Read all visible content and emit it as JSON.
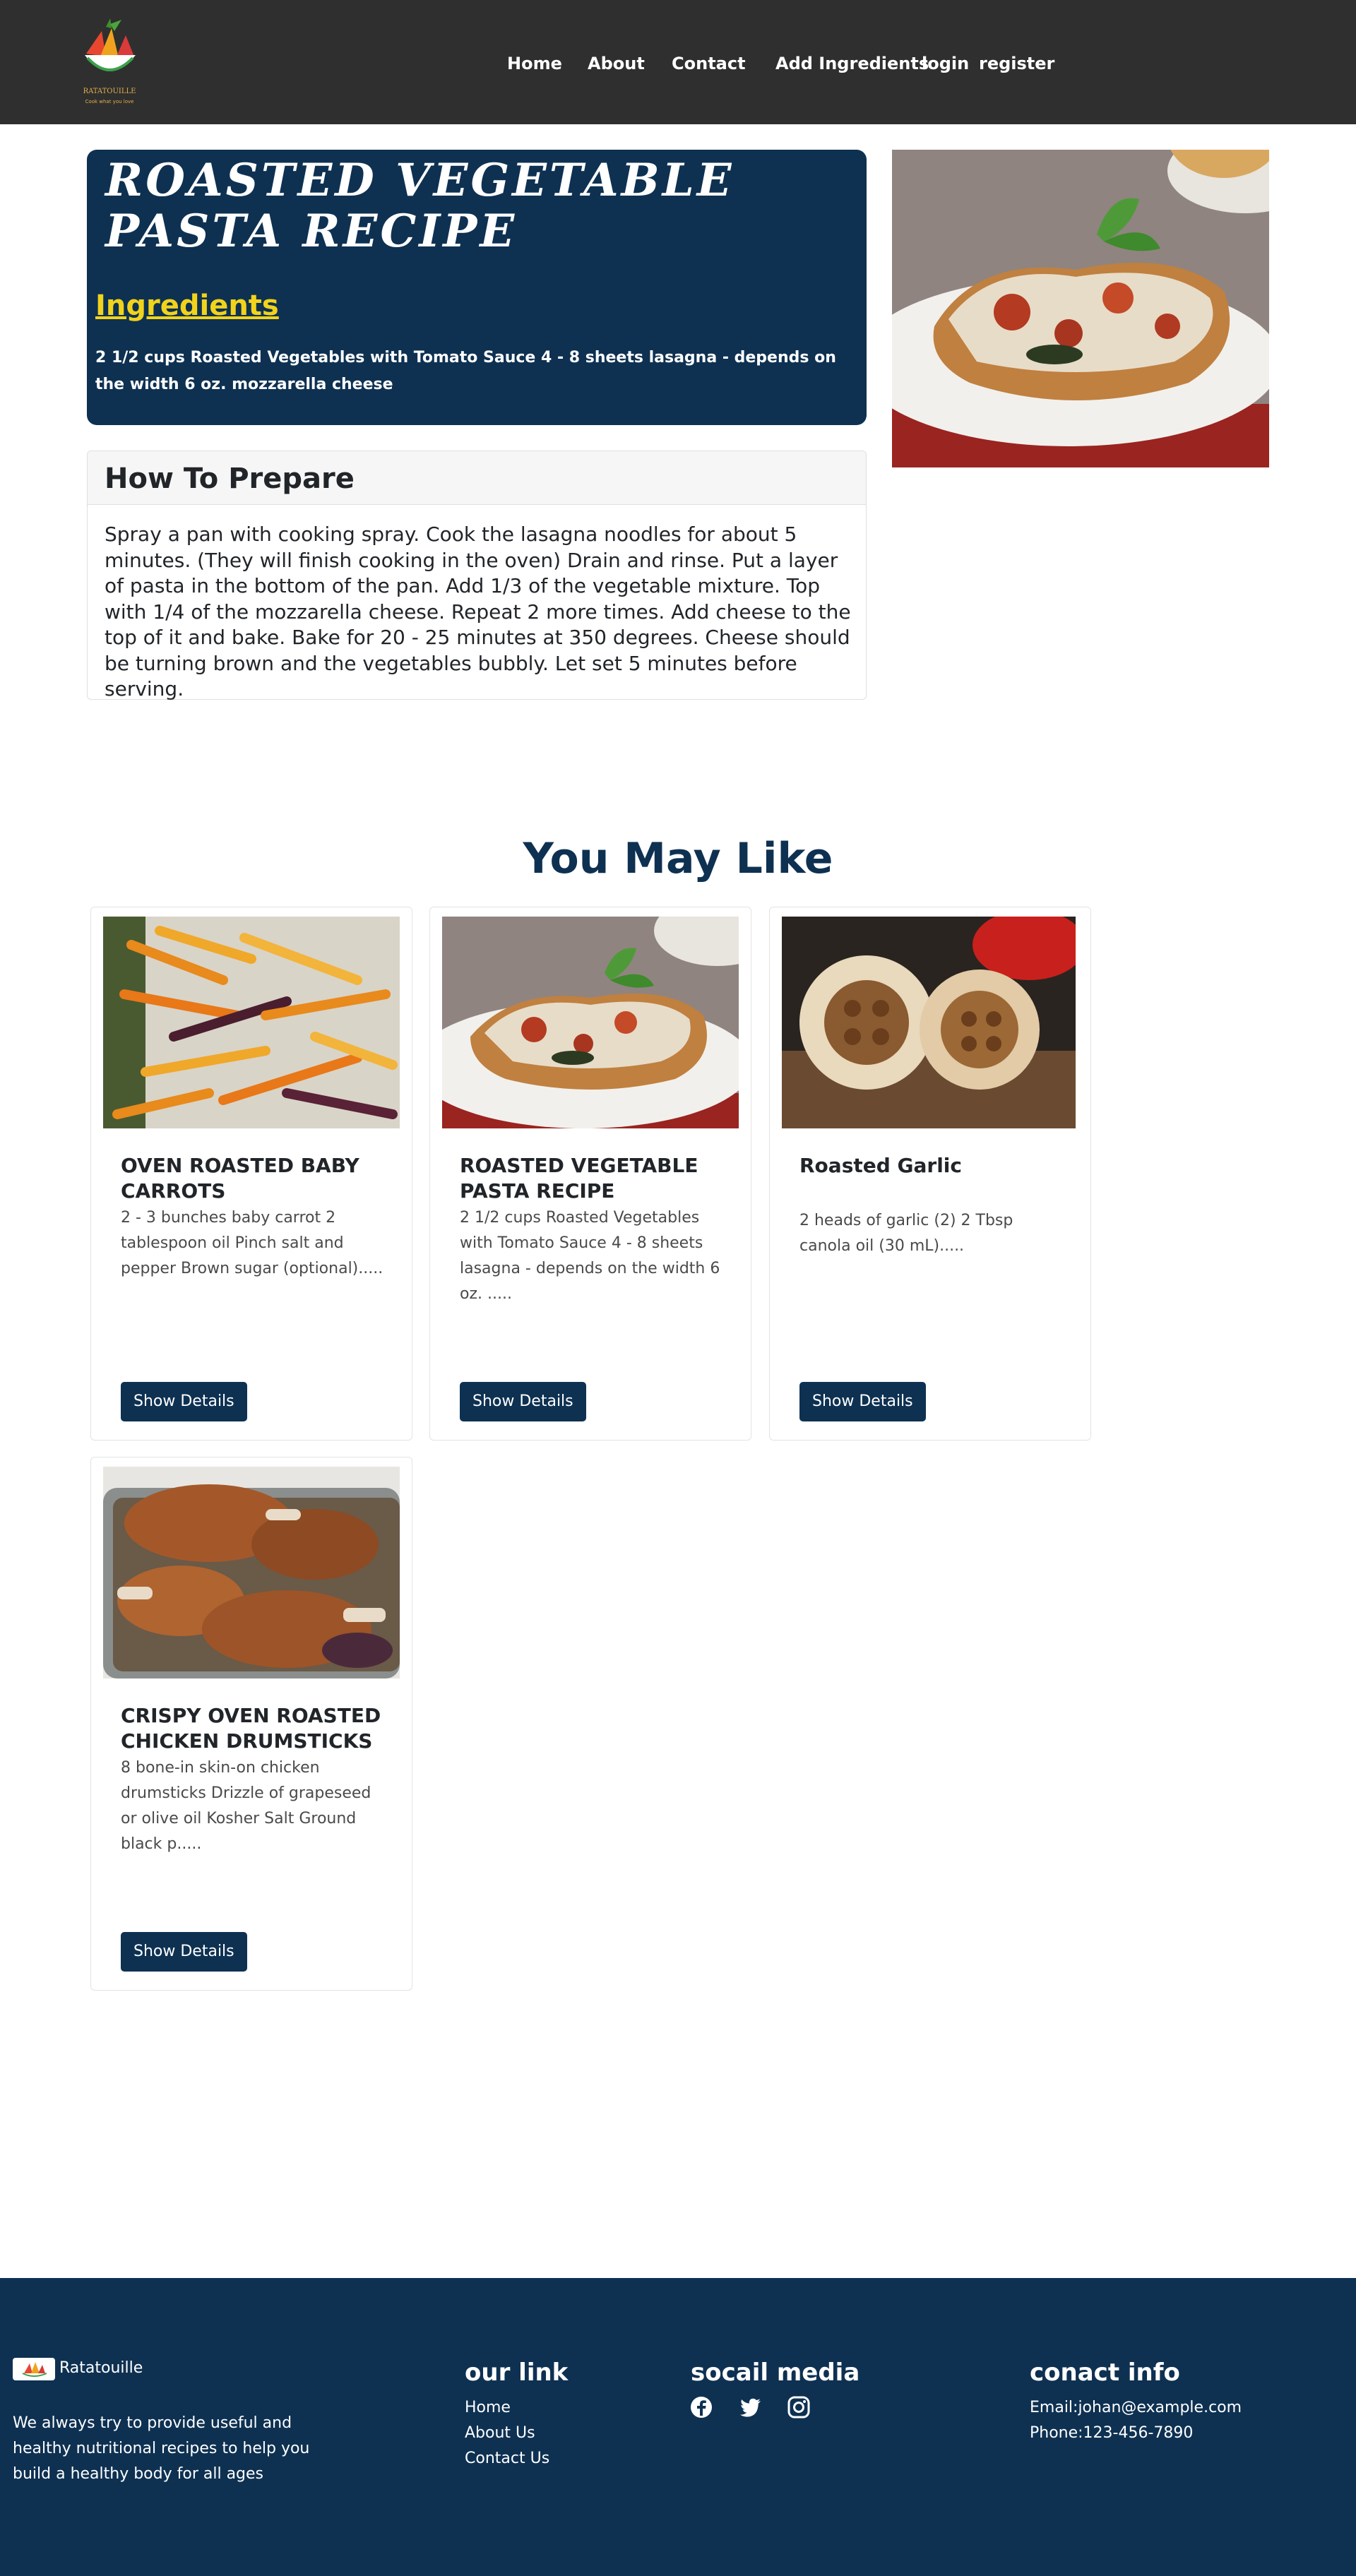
{
  "nav": {
    "brand": "RATATOUILLE",
    "tagline": "Cook what you love",
    "links": [
      "Home",
      "About",
      "Contact",
      "Add Ingredients",
      "login",
      "register"
    ]
  },
  "recipe": {
    "title": "ROASTED VEGETABLE PASTA RECIPE",
    "ingredients_heading": "Ingredients",
    "ingredients": "2 1/2 cups Roasted Vegetables with Tomato Sauce 4 - 8 sheets lasagna - depends on the width 6 oz. mozzarella cheese",
    "image": "lasagna-photo"
  },
  "prepare": {
    "heading": "How To Prepare",
    "text": "Spray a pan with cooking spray. Cook the lasagna noodles for about 5 minutes. (They will finish cooking in the oven) Drain and rinse. Put a layer of pasta in the bottom of the pan. Add 1/3 of the vegetable mixture. Top with 1/4 of the mozzarella cheese. Repeat 2 more times. Add cheese to the top of it and bake. Bake for 20 - 25 minutes at 350 degrees. Cheese should be turning brown and the vegetables bubbly. Let set 5 minutes before serving."
  },
  "may_like": {
    "heading": "You May Like",
    "cards": [
      {
        "title": "OVEN ROASTED BABY CARROTS",
        "text": "2 - 3 bunches baby carrot 2 tablespoon oil Pinch salt and pepper Brown sugar (optional).....",
        "button": "Show Details",
        "image": "carrots-photo"
      },
      {
        "title": "ROASTED VEGETABLE PASTA RECIPE",
        "text": "2 1/2 cups Roasted Vegetables with Tomato Sauce 4 - 8 sheets lasagna - depends on the width 6 oz. .....",
        "button": "Show Details",
        "image": "lasagna-photo"
      },
      {
        "title": "Roasted Garlic",
        "text": "2 heads of garlic (2) 2 Tbsp canola oil (30 mL).....",
        "button": "Show Details",
        "image": "garlic-photo"
      },
      {
        "title": "CRISPY OVEN ROASTED CHICKEN DRUMSTICKS",
        "text": "8 bone-in skin-on chicken drumsticks Drizzle of grapeseed or olive oil Kosher Salt Ground black p.....",
        "button": "Show Details",
        "image": "drumsticks-photo"
      }
    ]
  },
  "footer": {
    "brand": "Ratatouille",
    "about": "We always try to provide useful and healthy nutritional recipes to help you build a healthy body for all ages",
    "links_heading": "our link",
    "links": [
      "Home",
      "About Us",
      "Contact Us"
    ],
    "social_heading": "socail media",
    "social_icons": [
      "facebook-icon",
      "twitter-icon",
      "instagram-icon"
    ],
    "contact_heading": "conact info",
    "email": "Email:johan@example.com",
    "phone": "Phone:123-456-7890"
  },
  "colors": {
    "navbar": "#2f2f2f",
    "primary": "#0e3152",
    "accent": "#f2d31b"
  }
}
